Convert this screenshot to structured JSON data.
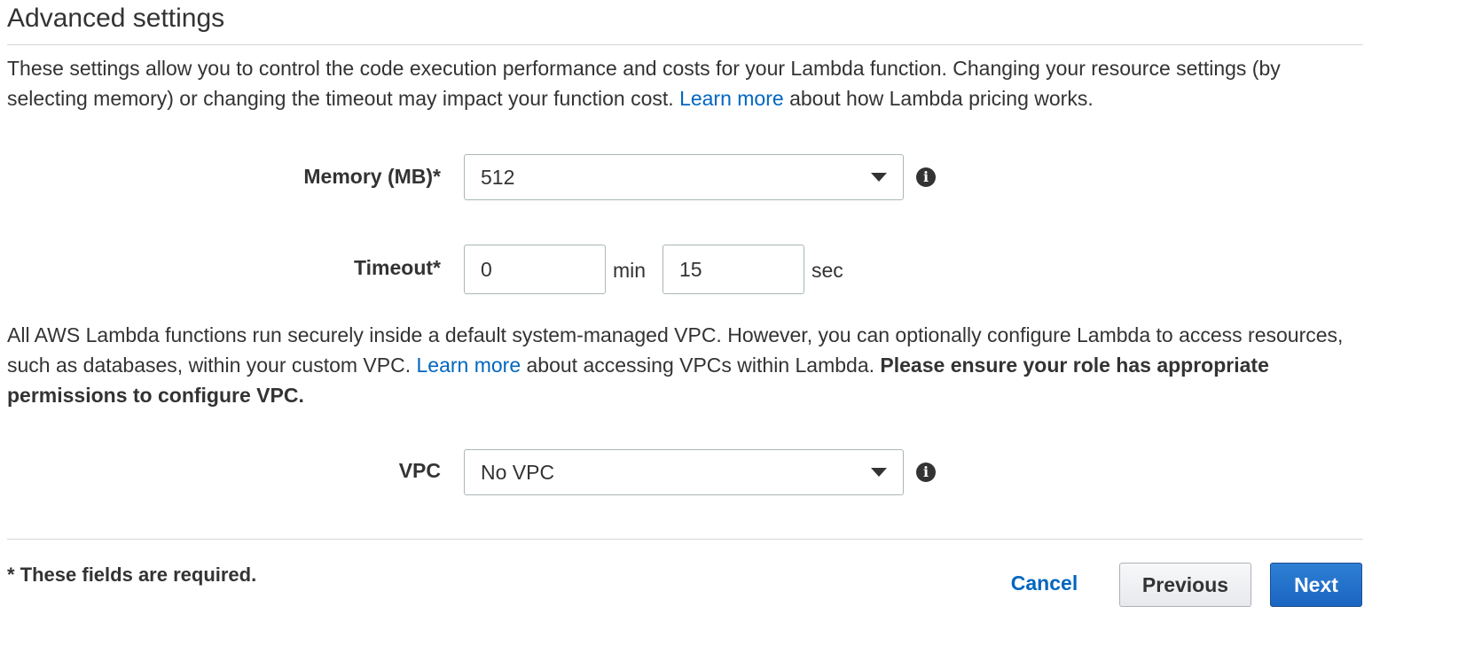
{
  "section": {
    "title": "Advanced settings",
    "intro_before_link": "These settings allow you to control the code execution performance and costs for your Lambda function. Changing your resource settings (by selecting memory) or changing the timeout may impact your function cost. ",
    "intro_link": "Learn more",
    "intro_after_link": " about how Lambda pricing works."
  },
  "memory": {
    "label": "Memory (MB)*",
    "value": "512",
    "info_icon": "info-icon"
  },
  "timeout": {
    "label": "Timeout*",
    "minutes": "0",
    "minutes_unit": "min",
    "seconds": "15",
    "seconds_unit": "sec"
  },
  "vpc_info": {
    "before_link": "All AWS Lambda functions run securely inside a default system-managed VPC. However, you can optionally configure Lambda to access resources, such as databases, within your custom VPC. ",
    "link": "Learn more",
    "after_link": " about accessing VPCs within Lambda. ",
    "bold": "Please ensure your role has appropriate permissions to configure VPC."
  },
  "vpc": {
    "label": "VPC",
    "value": "No VPC",
    "info_icon": "info-icon"
  },
  "footer": {
    "required_note": "* These fields are required.",
    "cancel_label": "Cancel",
    "previous_label": "Previous",
    "next_label": "Next"
  },
  "colors": {
    "link": "#0066c0",
    "primary_button": "#1a65c1",
    "text": "#333333",
    "border": "#aab7b8"
  }
}
